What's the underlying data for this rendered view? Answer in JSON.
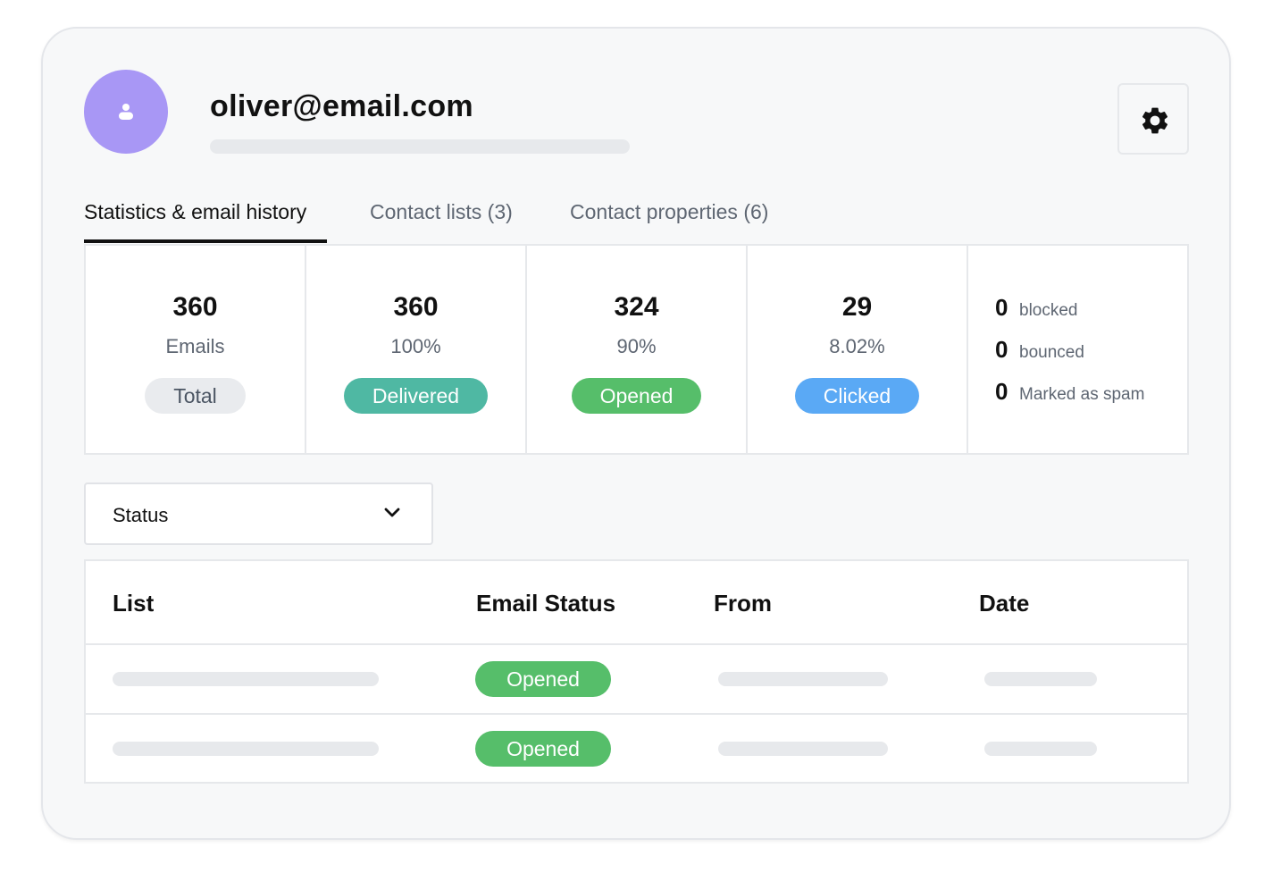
{
  "contact": {
    "email": "oliver@email.com",
    "avatar_icon": "user-icon",
    "settings_icon": "gear-icon"
  },
  "tabs": [
    {
      "label": "Statistics & email history",
      "active": true
    },
    {
      "label": "Contact lists (3)",
      "active": false
    },
    {
      "label": "Contact properties (6)",
      "active": false
    }
  ],
  "stats": [
    {
      "value": "360",
      "sub": "Emails",
      "badge": "Total",
      "badge_bg": "#e9ebee",
      "badge_color": "#4b5563"
    },
    {
      "value": "360",
      "sub": "100%",
      "badge": "Delivered",
      "badge_bg": "#4fb8a3",
      "badge_color": "#ffffff"
    },
    {
      "value": "324",
      "sub": "90%",
      "badge": "Opened",
      "badge_bg": "#56be6a",
      "badge_color": "#ffffff"
    },
    {
      "value": "29",
      "sub": "8.02%",
      "badge": "Clicked",
      "badge_bg": "#5aa9f5",
      "badge_color": "#ffffff"
    }
  ],
  "counts": [
    {
      "value": "0",
      "label": "blocked"
    },
    {
      "value": "0",
      "label": "bounced"
    },
    {
      "value": "0",
      "label": "Marked as spam"
    }
  ],
  "filter": {
    "label": "Status",
    "icon": "chevron-down-icon"
  },
  "table": {
    "headers": {
      "list": "List",
      "email_status": "Email Status",
      "from": "From",
      "date": "Date"
    },
    "rows": [
      {
        "status": "Opened"
      },
      {
        "status": "Opened"
      }
    ]
  },
  "colors": {
    "avatar": "#a897f5",
    "opened": "#56be6a",
    "delivered": "#4fb8a3",
    "clicked": "#5aa9f5"
  }
}
